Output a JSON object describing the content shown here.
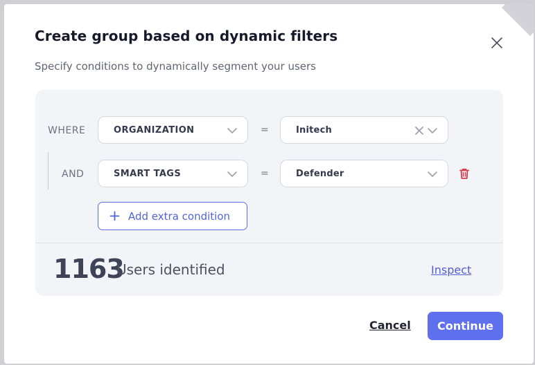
{
  "dialog": {
    "title": "Create group based on dynamic filters",
    "subtitle": "Specify conditions to dynamically segment your users"
  },
  "conditions": [
    {
      "keyword": "WHERE",
      "field": "ORGANIZATION",
      "operator": "=",
      "value": "Initech",
      "clearable": true
    },
    {
      "keyword": "AND",
      "field": "SMART TAGS",
      "operator": "=",
      "value": "Defender",
      "clearable": false
    }
  ],
  "add_condition_label": "Add extra condition",
  "result": {
    "count": "1163",
    "label": "Users identified",
    "inspect_label": "Inspect"
  },
  "footer": {
    "cancel_label": "Cancel",
    "continue_label": "Continue"
  },
  "colors": {
    "accent": "#5f70ef",
    "danger": "#d63a4a",
    "panel": "#f3f4f7"
  },
  "icons": {
    "close": "close-icon",
    "chevron": "chevron-down-icon",
    "clear": "clear-x-icon",
    "trash": "trash-icon",
    "plus": "plus-icon"
  }
}
